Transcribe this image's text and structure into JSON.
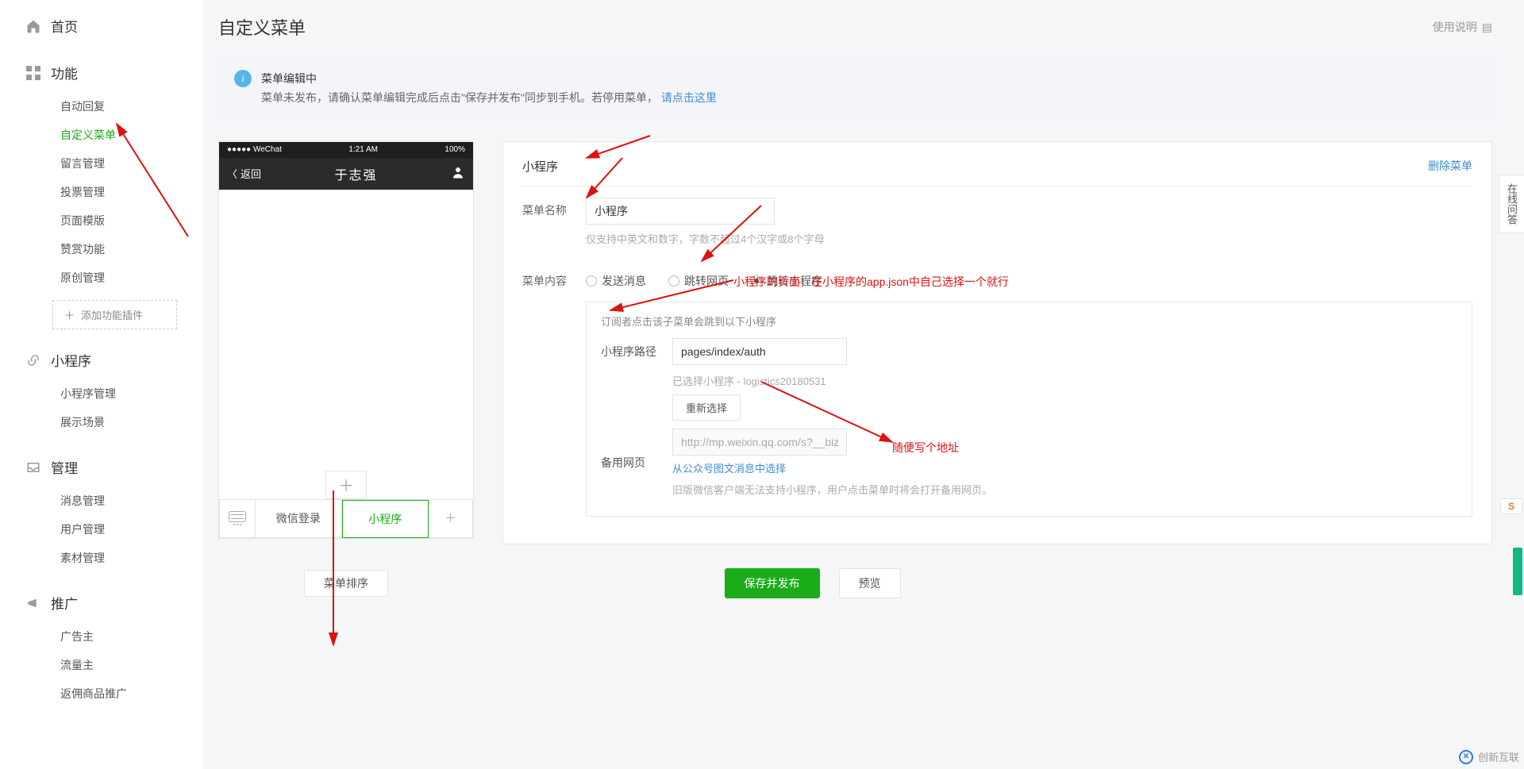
{
  "sidebar": {
    "home": "首页",
    "sections": [
      {
        "title": "功能",
        "items": [
          "自动回复",
          "自定义菜单",
          "留言管理",
          "投票管理",
          "页面模版",
          "赞赏功能",
          "原创管理"
        ],
        "plugin": "添加功能插件",
        "active_index": 1
      },
      {
        "title": "小程序",
        "items": [
          "小程序管理",
          "展示场景"
        ]
      },
      {
        "title": "管理",
        "items": [
          "消息管理",
          "用户管理",
          "素材管理"
        ]
      },
      {
        "title": "推广",
        "items": [
          "广告主",
          "流量主",
          "返佣商品推广"
        ]
      }
    ]
  },
  "page": {
    "title": "自定义菜单",
    "help": "使用说明"
  },
  "notice": {
    "line1": "菜单编辑中",
    "line2_a": "菜单未发布，请确认菜单编辑完成后点击\"保存并发布\"同步到手机。若停用菜单，",
    "line2_link": "请点击这里"
  },
  "phone": {
    "carrier": "●●●●● WeChat",
    "time": "1:21 AM",
    "battery": "100%",
    "back": "返回",
    "title": "于志强",
    "menu1": "微信登录",
    "menu2": "小程序"
  },
  "panel": {
    "type_label": "小程序",
    "delete": "删除菜单",
    "name_label": "菜单名称",
    "name_value": "小程序",
    "name_hint": "仅支持中英文和数字，字数不超过4个汉字或8个字母",
    "content_label": "菜单内容",
    "radio1": "发送消息",
    "radio2": "跳转网页",
    "radio3": "跳转小程序",
    "sub_hint": "订阅者点击该子菜单会跳到以下小程序",
    "path_label": "小程序路径",
    "path_value": "pages/index/auth",
    "selected_label": "已选择小程序 - logistics20180531",
    "reselect": "重新选择",
    "fallback_label": "备用网页",
    "fallback_value": "http://mp.weixin.qq.com/s?__biz=MzA",
    "fallback_link": "从公众号图文消息中选择",
    "fallback_hint": "旧版微信客户端无法支持小程序，用户点击菜单时将会打开备用网页。"
  },
  "annotations": {
    "line1": "小程序的页面，在小程序的app.json中自己选择一个就行",
    "line2": "随便写个地址"
  },
  "actions": {
    "sort": "菜单排序",
    "save": "保存并发布",
    "preview": "预览"
  },
  "float": "在线问答",
  "brand": "创新互联"
}
